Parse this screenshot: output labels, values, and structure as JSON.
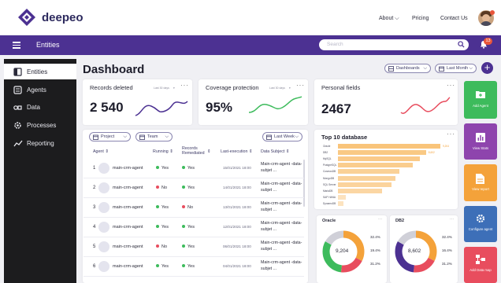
{
  "header": {
    "brand": "deepeo",
    "nav_about": "About",
    "nav_pricing": "Pricing",
    "nav_contact": "Contact Us"
  },
  "subheader": {
    "page_name": "Entities",
    "search_placeholder": "Search",
    "notifications_count": "13"
  },
  "sidebar": {
    "items": [
      {
        "label": "Entities",
        "icon": "entities-icon"
      },
      {
        "label": "Agents",
        "icon": "agents-icon"
      },
      {
        "label": "Data",
        "icon": "data-icon"
      },
      {
        "label": "Processes",
        "icon": "processes-icon"
      },
      {
        "label": "Reporting",
        "icon": "reporting-icon"
      }
    ]
  },
  "dashboard": {
    "title": "Dashboard",
    "dashboards_dropdown": "Dashboards",
    "period_dropdown": "Last Month"
  },
  "kpis": [
    {
      "title": "Records deleted",
      "since": "Last 30 days",
      "value": "2 540",
      "color": "#4c3192"
    },
    {
      "title": "Coverage protection",
      "since": "Last 30 days",
      "value": "95%",
      "color": "#3dbb5c"
    },
    {
      "title": "Personal fields",
      "value": "2467",
      "color": "#e84d5e"
    }
  ],
  "filters": {
    "project": "Project",
    "team": "Team",
    "period": "Last Week"
  },
  "table": {
    "columns": [
      "Agent",
      "Running",
      "Records Remediated",
      "Last-execution",
      "Data Subject"
    ],
    "rows": [
      {
        "n": "1",
        "agent": "main-crm-agent",
        "running": "Yes",
        "running_ok": true,
        "remediated": "Yes",
        "remediated_ok": true,
        "last": "15/01/2021 18:00",
        "subject": "Main-crm-agent -data-subjet ..."
      },
      {
        "n": "2",
        "agent": "main-crm-agent",
        "running": "No",
        "running_ok": false,
        "remediated": "Yes",
        "remediated_ok": true,
        "last": "14/01/2021 18:00",
        "subject": "Main-crm-agent -data-subjet ..."
      },
      {
        "n": "3",
        "agent": "main-crm-agent",
        "running": "Yes",
        "running_ok": true,
        "remediated": "No",
        "remediated_ok": false,
        "last": "13/01/2021 18:00",
        "subject": "Main-crm-agent -data-subjet ..."
      },
      {
        "n": "4",
        "agent": "main-crm-agent",
        "running": "Yes",
        "running_ok": true,
        "remediated": "Yes",
        "remediated_ok": true,
        "last": "12/01/2021 18:00",
        "subject": "Main-crm-agent -data-subjet ..."
      },
      {
        "n": "5",
        "agent": "main-crm-agent",
        "running": "No",
        "running_ok": false,
        "remediated": "Yes",
        "remediated_ok": true,
        "last": "06/01/2021 18:00",
        "subject": "Main-crm-agent -data-subjet ..."
      },
      {
        "n": "6",
        "agent": "main-crm-agent",
        "running": "Yes",
        "running_ok": true,
        "remediated": "Yes",
        "remediated_ok": true,
        "last": "04/01/2021 18:00",
        "subject": "Main-crm-agent -data-subjet ..."
      }
    ]
  },
  "top10": {
    "title": "Top 10 database",
    "items": [
      {
        "name": "Oracle",
        "value": 100,
        "label": "9,204"
      },
      {
        "name": "DB2",
        "value": 86,
        "label": "8,602"
      },
      {
        "name": "MySQL",
        "value": 80,
        "label": ""
      },
      {
        "name": "PostgreSQL",
        "value": 73,
        "label": ""
      },
      {
        "name": "CosmosDB",
        "value": 60,
        "label": ""
      },
      {
        "name": "MongoDB",
        "value": 56,
        "label": ""
      },
      {
        "name": "SQL Server",
        "value": 52,
        "label": ""
      },
      {
        "name": "MariaDB",
        "value": 43,
        "label": ""
      },
      {
        "name": "SAP HANA",
        "value": 8,
        "label": ""
      },
      {
        "name": "DynamoDB",
        "value": 5,
        "label": ""
      }
    ]
  },
  "donuts": [
    {
      "title": "Oracle",
      "total": "9,204",
      "segments": [
        {
          "pct": 32.4,
          "color": "#f4a23a"
        },
        {
          "pct": 19.4,
          "color": "#e84d5e"
        },
        {
          "pct": 31.2,
          "color": "#3dbb5c"
        },
        {
          "pct": 17.0,
          "color": "#d0d0d8"
        }
      ],
      "legend": [
        "32.4%",
        "19.4%",
        "31.2%"
      ]
    },
    {
      "title": "DB2",
      "total": "8,602",
      "segments": [
        {
          "pct": 32.4,
          "color": "#f4a23a"
        },
        {
          "pct": 19.4,
          "color": "#e84d5e"
        },
        {
          "pct": 31.2,
          "color": "#4c3192"
        },
        {
          "pct": 17.0,
          "color": "#d0d0d8"
        }
      ],
      "legend": [
        "32.4%",
        "16.4%",
        "31.2%"
      ]
    }
  ],
  "quick_actions": [
    {
      "label": "Add Agent",
      "color": "#3dbb5c",
      "icon": "add-folder-icon"
    },
    {
      "label": "View Stats",
      "color": "#8e44ad",
      "icon": "stats-icon"
    },
    {
      "label": "View report",
      "color": "#f4a23a",
      "icon": "report-icon"
    },
    {
      "label": "Configure agent",
      "color": "#3d6fb8",
      "icon": "gear-icon"
    },
    {
      "label": "Add Data map",
      "color": "#e84d5e",
      "icon": "data-map-icon"
    }
  ]
}
